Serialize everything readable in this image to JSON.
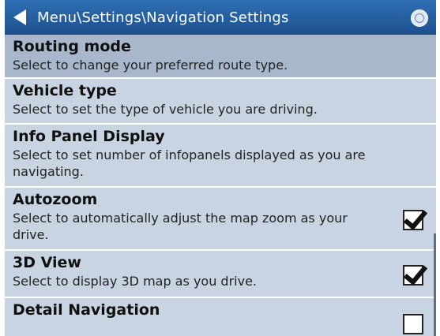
{
  "header": {
    "title": "Menu\\Settings\\Navigation Settings"
  },
  "items": [
    {
      "title": "Routing mode",
      "desc": "Select to change your preferred route type."
    },
    {
      "title": "Vehicle type",
      "desc": "Select to set the type of vehicle you are driving."
    },
    {
      "title": "Info Panel Display",
      "desc": "Select to set number of infopanels displayed as you are navigating."
    },
    {
      "title": "Autozoom",
      "desc": "Select to automatically adjust the map zoom as your drive.",
      "checked": true
    },
    {
      "title": "3D View",
      "desc": "Select to display 3D map as you drive.",
      "checked": true
    },
    {
      "title": "Detail Navigation",
      "checked": false
    }
  ]
}
